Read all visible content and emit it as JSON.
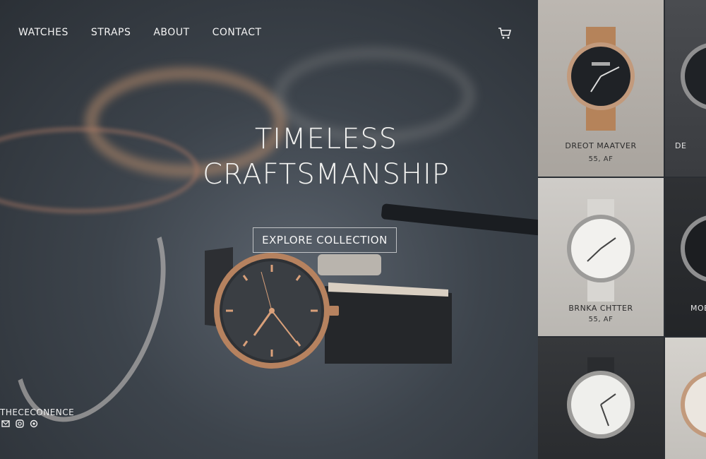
{
  "nav": {
    "items": [
      "WATCHES",
      "STRAPS",
      "ABOUT",
      "CONTACT"
    ]
  },
  "hero": {
    "headline_line1": "TIMELESS",
    "headline_line2": "CRAFTSMANSHIP",
    "cta_label": "EXPLORE COLLECTION"
  },
  "footer": {
    "brand": "THECECONENCE",
    "social_icons": [
      "mail-icon",
      "instagram-icon",
      "circle-icon"
    ]
  },
  "products": [
    {
      "name": "DREOT MAATVER",
      "price": "55, AF"
    },
    {
      "name": "DE",
      "price": ""
    },
    {
      "name": "BRNKA CHTTER",
      "price": "55, AF"
    },
    {
      "name": "MOE",
      "price": ""
    },
    {
      "name": "",
      "price": ""
    },
    {
      "name": "",
      "price": ""
    }
  ],
  "colors": {
    "accent_rose_gold": "#c08a64",
    "hero_bg": "#3d444c",
    "tile_light": "#c9c6c2",
    "tile_dark": "#2e3033"
  }
}
